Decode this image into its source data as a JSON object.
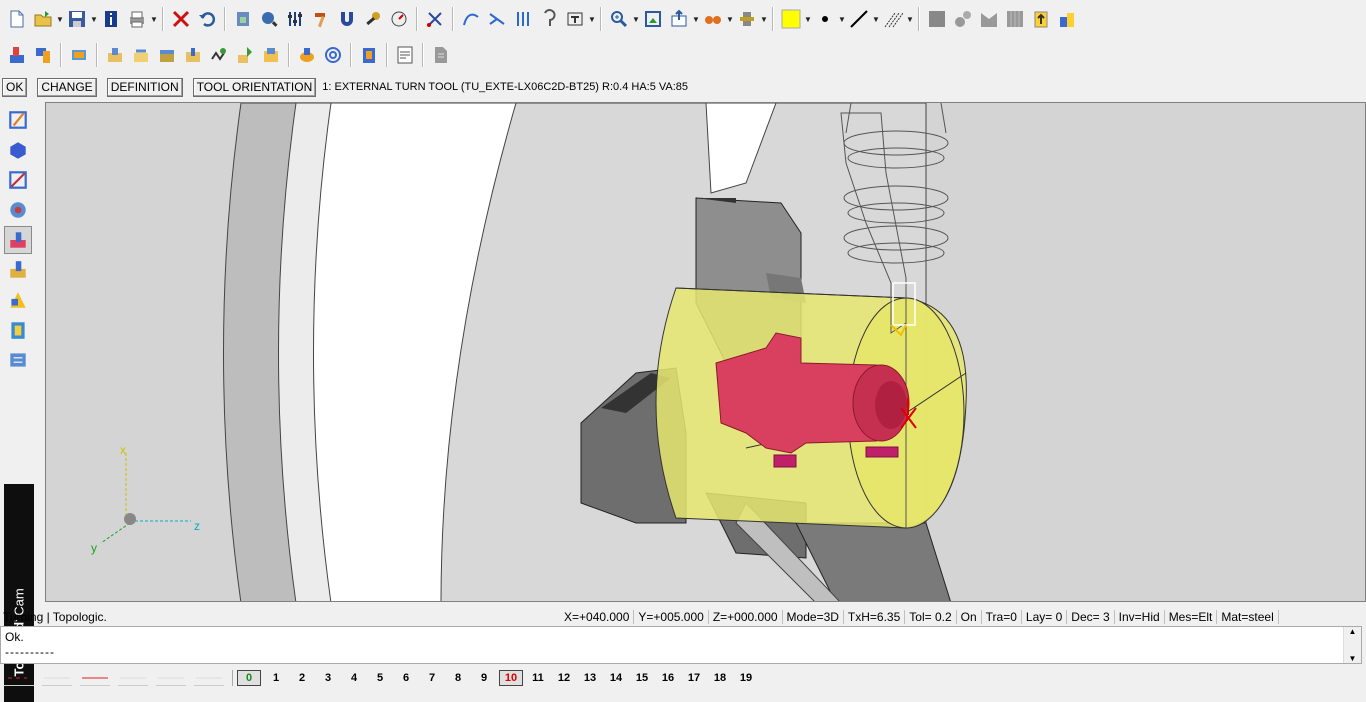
{
  "command_bar": {
    "ok": "OK",
    "change": "CHANGE",
    "definition": "DEFINITION",
    "tool_orientation": "TOOL ORIENTATION",
    "info": "1: EXTERNAL TURN TOOL (TU_EXTE-LX06C2D-BT25)  R:0.4  HA:5  VA:85"
  },
  "brand": {
    "name": "TopSolid",
    "suffix": "' Cam"
  },
  "axis_triad": {
    "x": "x",
    "y": "y",
    "z": "z"
  },
  "status": {
    "left": "Turning | Topologic.",
    "x": "X=+040.000",
    "y": "Y=+005.000",
    "z": "Z=+000.000",
    "mode": "Mode=3D",
    "txh": "TxH=6.35",
    "tol": "Tol=   0.2",
    "on": "On",
    "tra": "Tra=0",
    "lay": "Lay=  0",
    "dec": "Dec= 3",
    "inv": "Inv=Hid",
    "mes": "Mes=Elt",
    "mat": "Mat=steel"
  },
  "console": {
    "line1": "Ok.",
    "line2": "----------"
  },
  "layers": {
    "current": "0",
    "n1": "1",
    "n2": "2",
    "n3": "3",
    "n4": "4",
    "n5": "5",
    "n6": "6",
    "n7": "7",
    "n8": "8",
    "n9": "9",
    "n10": "10",
    "n11": "11",
    "n12": "12",
    "n13": "13",
    "n14": "14",
    "n15": "15",
    "n16": "16",
    "n17": "17",
    "n18": "18",
    "n19": "19"
  },
  "colors": {
    "accent_yellow": "#ffff00",
    "part_red": "#d94060",
    "stock_yellow": "#e8e870"
  },
  "icons": [
    "new-file-icon",
    "open-folder-icon",
    "save-icon",
    "info-icon",
    "print-icon",
    "delete-icon",
    "undo-icon"
  ]
}
